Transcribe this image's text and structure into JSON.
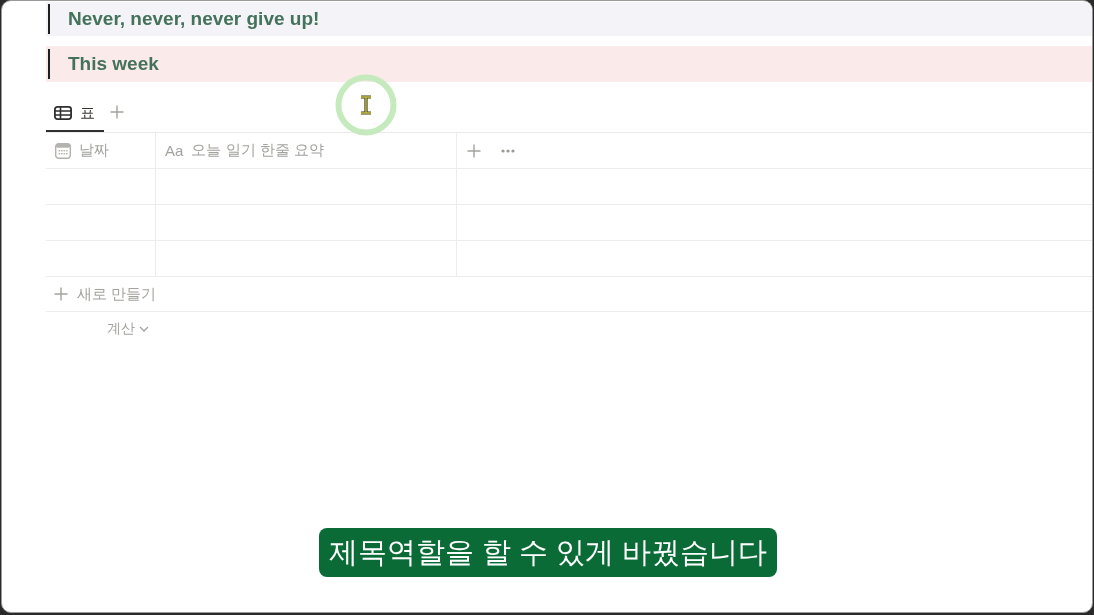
{
  "callouts": [
    {
      "text": "Never, never, never give up!",
      "color": "#f4f3f8"
    },
    {
      "text": "This week",
      "color": "#fbeaea"
    }
  ],
  "views": {
    "tabs": [
      {
        "label": "표",
        "selected": true
      }
    ]
  },
  "table": {
    "columns": [
      {
        "kind": "date",
        "label": "날짜"
      },
      {
        "kind": "title",
        "type_label": "Aa",
        "label": "오늘 일기 한줄 요약"
      }
    ],
    "rows": [
      {},
      {},
      {}
    ],
    "new_row_label": "새로 만들기",
    "calculate_label": "계산"
  },
  "subtitle": "제목역할을 할 수 있게 바꿨습니다"
}
